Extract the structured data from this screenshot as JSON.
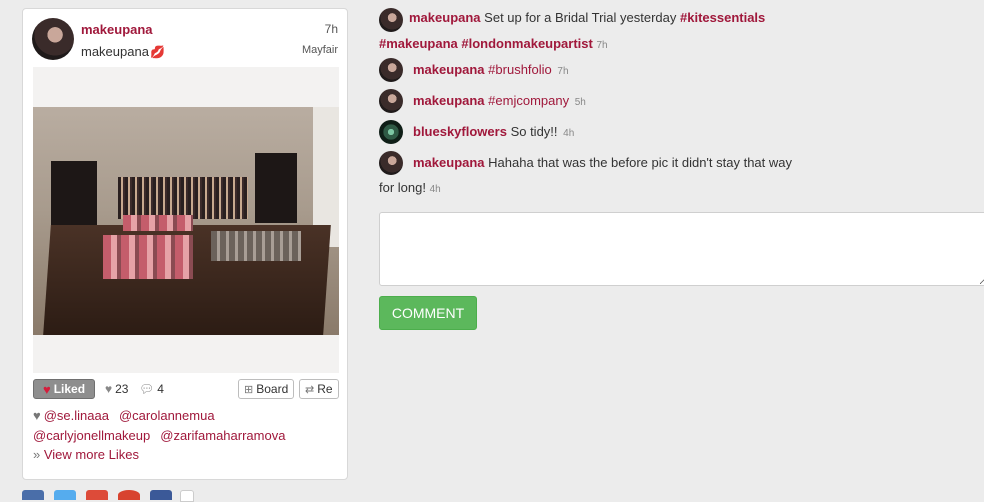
{
  "post": {
    "username": "makeupana",
    "display_name": "makeupana",
    "emoji": "💋",
    "time": "7h",
    "location": "Mayfair",
    "photo_icon": "makeup-table-photo",
    "actions": {
      "liked_label": "Liked",
      "like_count": "23",
      "comment_count": "4",
      "board_label": "Board",
      "repost_label": "Re"
    },
    "likers": [
      "@se.linaaa",
      "@carolannemua",
      "@carlyjonellmakeup",
      "@zarifamaharramova"
    ],
    "view_more_label": "View more Likes"
  },
  "comments": [
    {
      "user": "makeupana",
      "text": "Set up for a Bridal Trial yesterday",
      "tag1": "#kitessentials",
      "cont_tags": "#makeupana #londonmakeupartist",
      "time": "7h"
    },
    {
      "user": "makeupana",
      "tag": "#brushfolio",
      "time": "7h"
    },
    {
      "user": "makeupana",
      "tag": "#emjcompany",
      "time": "5h"
    },
    {
      "user": "blueskyflowers",
      "text": "So tidy!!",
      "time": "4h"
    },
    {
      "user": "makeupana",
      "text": "Hahaha that was the before pic it didn't stay that way",
      "cont": "for long!",
      "time": "4h"
    }
  ],
  "comment_input": {
    "placeholder": ""
  },
  "comment_button": "COMMENT",
  "colors": {
    "accent": "#a0183b",
    "button_green": "#5cb85c"
  }
}
